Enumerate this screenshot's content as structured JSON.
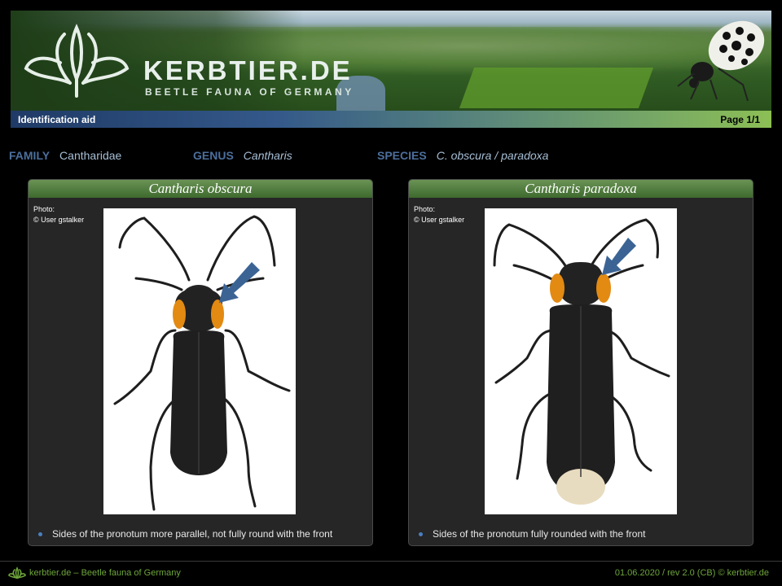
{
  "header": {
    "site_title": "KERBTIER.DE",
    "site_subtitle": "BEETLE FAUNA OF GERMANY",
    "bar_left": "Identification aid",
    "bar_right": "Page 1/1"
  },
  "taxonomy": {
    "family_label": "FAMILY",
    "family_value": "Cantharidae",
    "genus_label": "GENUS",
    "genus_value": "Cantharis",
    "species_label": "SPECIES",
    "species_value": "C. obscura / paradoxa"
  },
  "panels": [
    {
      "title": "Cantharis obscura",
      "credit_line1": "Photo:",
      "credit_line2": "© User gstalker",
      "note": "Sides of the pronotum more parallel, not fully round with the  front"
    },
    {
      "title": "Cantharis paradoxa",
      "credit_line1": "Photo:",
      "credit_line2": "© User gstalker",
      "note": "Sides of the pronotum fully rounded with the front"
    }
  ],
  "footer": {
    "left": "kerbtier.de – Beetle  fauna of Germany",
    "right": "01.06.2020 / rev 2.0 (CB) © kerbtier.de"
  },
  "colors": {
    "accent_green": "#6ea53a",
    "label_blue": "#4c6f9c",
    "arrow_blue": "#3b6495"
  }
}
